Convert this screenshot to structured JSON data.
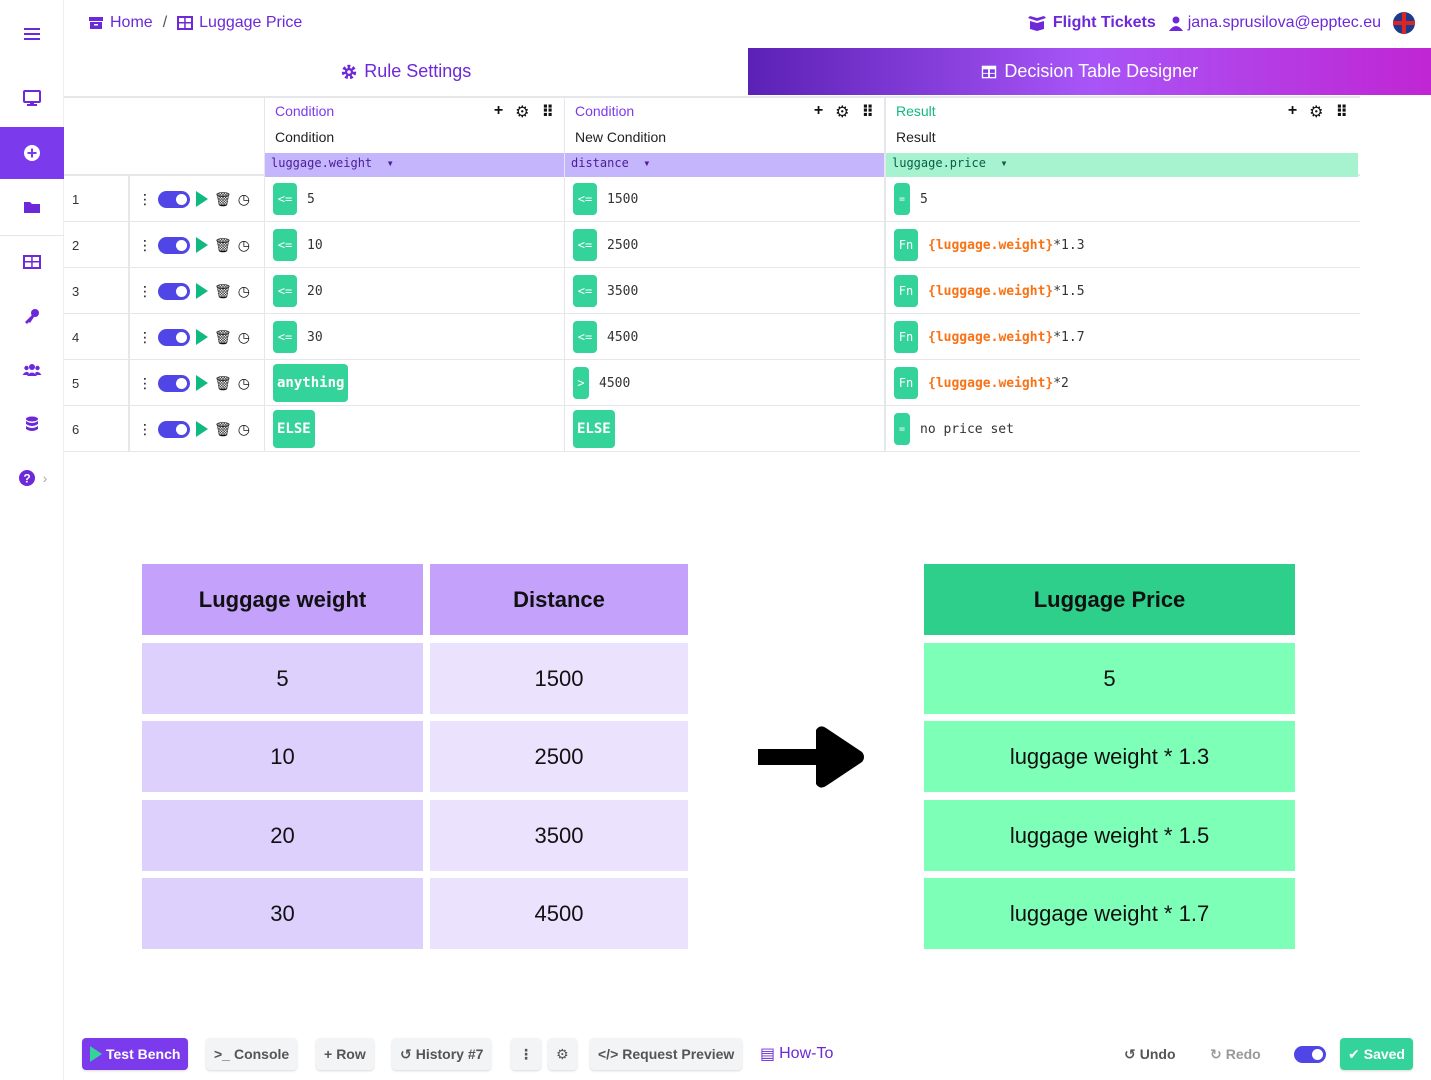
{
  "breadcrumb": {
    "home": "Home",
    "separator": "/",
    "current": "Luggage Price"
  },
  "header": {
    "project": "Flight Tickets",
    "user_email": "jana.sprusilova@epptec.eu"
  },
  "tabs": [
    {
      "label": "Rule Settings",
      "active": false
    },
    {
      "label": "Decision Table Designer",
      "active": true
    }
  ],
  "columns": [
    {
      "kind": "Condition",
      "title": "Condition",
      "field": "luggage.weight"
    },
    {
      "kind": "Condition",
      "title": "New Condition",
      "field": "distance"
    },
    {
      "kind": "Result",
      "title": "Result",
      "field": "luggage.price"
    }
  ],
  "column_tools": {
    "add": "+",
    "settings": "⚙",
    "drag": "⠿"
  },
  "rows": [
    {
      "num": "1",
      "c1_op": "<=",
      "c1_val": "5",
      "c2_op": "<=",
      "c2_val": "1500",
      "r_op": "=",
      "r_fn": "",
      "r_val": "5"
    },
    {
      "num": "2",
      "c1_op": "<=",
      "c1_val": "10",
      "c2_op": "<=",
      "c2_val": "2500",
      "r_op": "Fn",
      "r_fn": "{luggage.weight}",
      "r_val": "*1.3"
    },
    {
      "num": "3",
      "c1_op": "<=",
      "c1_val": "20",
      "c2_op": "<=",
      "c2_val": "3500",
      "r_op": "Fn",
      "r_fn": "{luggage.weight}",
      "r_val": "*1.5"
    },
    {
      "num": "4",
      "c1_op": "<=",
      "c1_val": "30",
      "c2_op": "<=",
      "c2_val": "4500",
      "r_op": "Fn",
      "r_fn": "{luggage.weight}",
      "r_val": "*1.7"
    },
    {
      "num": "5",
      "c1_op": "anything",
      "c1_val": "",
      "c2_op": ">",
      "c2_val": "4500",
      "r_op": "Fn",
      "r_fn": "{luggage.weight}",
      "r_val": "*2"
    },
    {
      "num": "6",
      "c1_op": "ELSE",
      "c1_val": "",
      "c2_op": "ELSE",
      "c2_val": "",
      "r_op": "=",
      "r_fn": "",
      "r_val": "no price set"
    }
  ],
  "illustration": {
    "left_headers": [
      "Luggage weight",
      "Distance"
    ],
    "left_rows": [
      [
        "5",
        "1500"
      ],
      [
        "10",
        "2500"
      ],
      [
        "20",
        "3500"
      ],
      [
        "30",
        "4500"
      ]
    ],
    "right_header": "Luggage Price",
    "right_rows": [
      "5",
      "luggage weight * 1.3",
      "luggage weight * 1.5",
      "luggage weight * 1.7"
    ]
  },
  "bottombar": {
    "test_bench": "Test Bench",
    "console": "Console",
    "row": "Row",
    "history": "History #7",
    "more": "⋮",
    "request_preview": "Request Preview",
    "how_to": "How-To",
    "undo": "Undo",
    "redo": "Redo",
    "saved": "Saved"
  },
  "colors": {
    "accent": "#7c3aed",
    "green": "#34d399",
    "condition_field": "#c4b5fd",
    "result_field": "#a7f3d0"
  }
}
